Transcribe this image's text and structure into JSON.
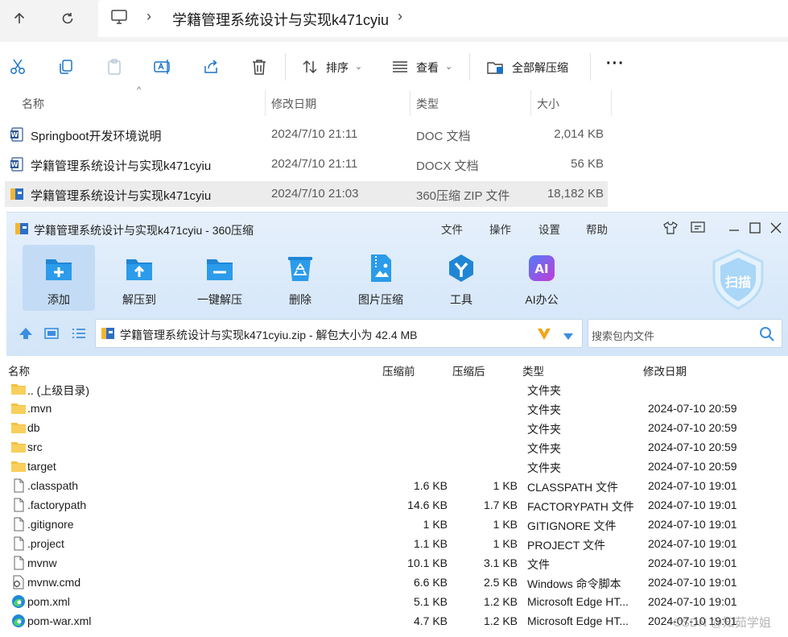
{
  "explorer": {
    "breadcrumb_title": "学籍管理系统设计与实现k471cyiu",
    "toolbar": {
      "sort_label": "排序",
      "view_label": "查看",
      "extract_all_label": "全部解压缩",
      "more_label": "···"
    },
    "columns": {
      "name": "名称",
      "date": "修改日期",
      "type": "类型",
      "size": "大小"
    },
    "files": [
      {
        "name": "Springboot开发环境说明",
        "date": "2024/7/10 21:11",
        "type": "DOC 文档",
        "size": "2,014 KB",
        "icon": "word-doc-icon"
      },
      {
        "name": "学籍管理系统设计与实现k471cyiu",
        "date": "2024/7/10 21:11",
        "type": "DOCX 文档",
        "size": "56 KB",
        "icon": "word-docx-icon"
      },
      {
        "name": "学籍管理系统设计与实现k471cyiu",
        "date": "2024/7/10 21:03",
        "type": "360压缩 ZIP 文件",
        "size": "18,182 KB",
        "icon": "zip-archive-icon"
      }
    ]
  },
  "zip_window": {
    "title": "学籍管理系统设计与实现k471cyiu - 360压缩",
    "menu": [
      "文件",
      "操作",
      "设置",
      "帮助"
    ],
    "tools": [
      "添加",
      "解压到",
      "一键解压",
      "删除",
      "图片压缩",
      "工具",
      "AI办公"
    ],
    "scan_label": "扫描",
    "path_text": "学籍管理系统设计与实现k471cyiu.zip - 解包大小为 42.4 MB",
    "search_placeholder": "搜索包内文件",
    "columns": {
      "name": "名称",
      "packed": "压缩前",
      "compressed": "压缩后",
      "type": "类型",
      "modified": "修改日期"
    },
    "rows": [
      {
        "name": ".. (上级目录)",
        "packed": "",
        "compressed": "",
        "type": "文件夹",
        "modified": "",
        "icon": "folder"
      },
      {
        "name": ".mvn",
        "packed": "",
        "compressed": "",
        "type": "文件夹",
        "modified": "2024-07-10 20:59",
        "icon": "folder"
      },
      {
        "name": "db",
        "packed": "",
        "compressed": "",
        "type": "文件夹",
        "modified": "2024-07-10 20:59",
        "icon": "folder"
      },
      {
        "name": "src",
        "packed": "",
        "compressed": "",
        "type": "文件夹",
        "modified": "2024-07-10 20:59",
        "icon": "folder"
      },
      {
        "name": "target",
        "packed": "",
        "compressed": "",
        "type": "文件夹",
        "modified": "2024-07-10 20:59",
        "icon": "folder"
      },
      {
        "name": ".classpath",
        "packed": "1.6 KB",
        "compressed": "1 KB",
        "type": "CLASSPATH 文件",
        "modified": "2024-07-10 19:01",
        "icon": "file"
      },
      {
        "name": ".factorypath",
        "packed": "14.6 KB",
        "compressed": "1.7 KB",
        "type": "FACTORYPATH 文件",
        "modified": "2024-07-10 19:01",
        "icon": "file"
      },
      {
        "name": ".gitignore",
        "packed": "1 KB",
        "compressed": "1 KB",
        "type": "GITIGNORE 文件",
        "modified": "2024-07-10 19:01",
        "icon": "file"
      },
      {
        "name": ".project",
        "packed": "1.1 KB",
        "compressed": "1 KB",
        "type": "PROJECT 文件",
        "modified": "2024-07-10 19:01",
        "icon": "file"
      },
      {
        "name": "mvnw",
        "packed": "10.1 KB",
        "compressed": "3.1 KB",
        "type": "文件",
        "modified": "2024-07-10 19:01",
        "icon": "file"
      },
      {
        "name": "mvnw.cmd",
        "packed": "6.6 KB",
        "compressed": "2.5 KB",
        "type": "Windows 命令脚本",
        "modified": "2024-07-10 19:01",
        "icon": "cmd"
      },
      {
        "name": "pom.xml",
        "packed": "5.1 KB",
        "compressed": "1.2 KB",
        "type": "Microsoft Edge HT...",
        "modified": "2024-07-10 19:01",
        "icon": "edge"
      },
      {
        "name": "pom-war.xml",
        "packed": "4.7 KB",
        "compressed": "1.2 KB",
        "type": "Microsoft Edge HT...",
        "modified": "2024-07-10 19:01",
        "icon": "edge"
      }
    ]
  },
  "watermark": "CSDN @知茹学姐",
  "colors": {
    "accent": "#1a73c9",
    "zip_bg": "#dcebfa",
    "selected_row": "#ececec"
  }
}
